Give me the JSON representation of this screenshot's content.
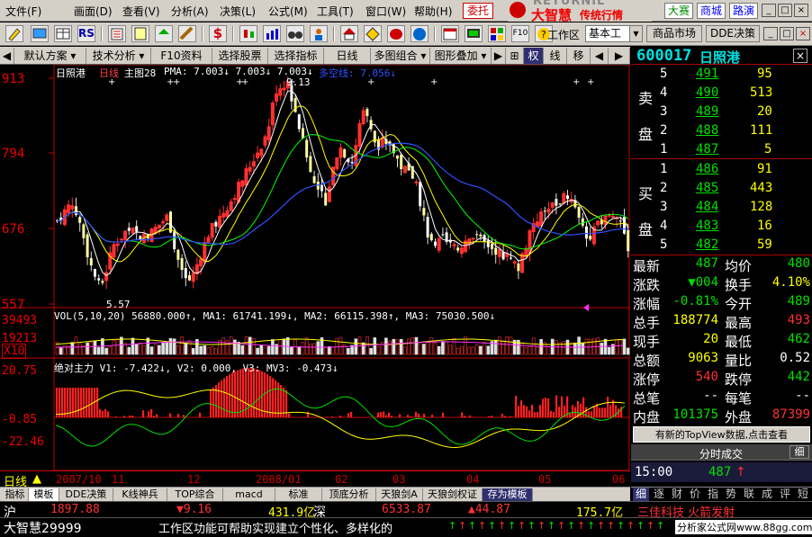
{
  "menu": {
    "items": [
      "文件(F)",
      "画面(D)",
      "查看(V)",
      "分析(A)",
      "决策(L)",
      "公式(M)",
      "工具(T)",
      "窗口(W)",
      "帮助(H)"
    ],
    "entrust": "委托",
    "logo_brand": "RETURNIL",
    "logo_main": "大智慧",
    "logo_sub": "传统行情",
    "btn_contest": "大赛",
    "btn_mall": "商城",
    "btn_roadshow": "路演",
    "win_min": "_",
    "win_max": "□",
    "win_close": "×"
  },
  "toolbar": {
    "icon_labels": [
      "RSI",
      "$",
      "F10"
    ],
    "workspace_label": "工作区",
    "workspace_value": "基本工",
    "btn_market": "商品市场",
    "btn_dde": "DDE决策"
  },
  "funcbar": {
    "items": [
      "默认方案",
      "技术分析",
      "F10资料",
      "选择股票",
      "选择指标",
      "日线",
      "多图组合",
      "图形叠加",
      "权",
      "线",
      "移"
    ]
  },
  "stock": {
    "code": "600017",
    "name": "日照港",
    "close_icon": "×"
  },
  "chart": {
    "name": "日照港",
    "period": "日线",
    "main_label": "主图28",
    "pma": "PMA: 7.003↓ 7.003↓ 7.003↓",
    "duo_kong": "多空线: 7.056↓",
    "high_mark": "9.13",
    "low_mark": "5.57",
    "y_labels": [
      "913",
      "794",
      "676",
      "557"
    ],
    "vol_line": "VOL(5,10,20) 56880.000↑, MA1: 61741.199↓, MA2: 66115.398↑, MA3: 75030.500↓",
    "vol_y": [
      "39493",
      "19213",
      "X10"
    ],
    "ind_line": "绝对主力  V1: -7.422↓, V2: 0.000, V3: MV3: -0.473↓",
    "ind_y": [
      "20.75",
      "-0.85",
      "-22.46"
    ],
    "x_period": "日线",
    "x_labels": [
      "2007/10",
      "11",
      "12",
      "2008/01",
      "02",
      "03",
      "04",
      "05",
      "06"
    ]
  },
  "quote": {
    "sell_title": "卖",
    "sell_title2": "盘",
    "buy_title": "买",
    "buy_title2": "盘",
    "sells": [
      {
        "lvl": "5",
        "price": "491",
        "vol": "95"
      },
      {
        "lvl": "4",
        "price": "490",
        "vol": "513"
      },
      {
        "lvl": "3",
        "price": "489",
        "vol": "20"
      },
      {
        "lvl": "2",
        "price": "488",
        "vol": "111"
      },
      {
        "lvl": "1",
        "price": "487",
        "vol": "5"
      }
    ],
    "buys": [
      {
        "lvl": "1",
        "price": "486",
        "vol": "91"
      },
      {
        "lvl": "2",
        "price": "485",
        "vol": "443"
      },
      {
        "lvl": "3",
        "price": "484",
        "vol": "128"
      },
      {
        "lvl": "4",
        "price": "483",
        "vol": "16"
      },
      {
        "lvl": "5",
        "price": "482",
        "vol": "59"
      }
    ],
    "stats": [
      {
        "l1": "最新",
        "v1": "487",
        "c1": "#00e000",
        "l2": "均价",
        "v2": "480",
        "c2": "#00e000"
      },
      {
        "l1": "涨跌",
        "v1": "▼004",
        "c1": "#00e000",
        "l2": "换手",
        "v2": "4.10%",
        "c2": "#ffff00"
      },
      {
        "l1": "涨幅",
        "v1": "-0.81%",
        "c1": "#00e000",
        "l2": "今开",
        "v2": "489",
        "c2": "#00e000"
      },
      {
        "l1": "总手",
        "v1": "188774",
        "c1": "#ffff00",
        "l2": "最高",
        "v2": "493",
        "c2": "#ff3030"
      },
      {
        "l1": "现手",
        "v1": "20",
        "c1": "#ffff00",
        "l2": "最低",
        "v2": "462",
        "c2": "#00e000"
      },
      {
        "l1": "总额",
        "v1": "9063",
        "c1": "#ffff00",
        "l2": "量比",
        "v2": "0.52",
        "c2": "#ffffff"
      },
      {
        "l1": "涨停",
        "v1": "540",
        "c1": "#ff3030",
        "l2": "跌停",
        "v2": "442",
        "c2": "#00e000"
      },
      {
        "l1": "总笔",
        "v1": "--",
        "c1": "#ffffff",
        "l2": "每笔",
        "v2": "--",
        "c2": "#ffffff"
      },
      {
        "l1": "内盘",
        "v1": "101375",
        "c1": "#00e000",
        "l2": "外盘",
        "v2": "87399",
        "c2": "#ff3030"
      }
    ],
    "topview": "有新的TopView数据,点击查看",
    "tick_header": "分时成交",
    "tick_btn": "细",
    "tick_time": "15:00",
    "tick_price": "487",
    "tick_arrow": "↑",
    "tabs": [
      "细",
      "逐",
      "财",
      "价",
      "指",
      "势",
      "联",
      "成",
      "评",
      "短"
    ]
  },
  "bottomtabs": [
    "指标",
    "模板",
    "DDE决策",
    "K线神兵",
    "TOP综合",
    "macd",
    "标准",
    "顶底分析",
    "天狼剑A",
    "天狼剑权证",
    "存为模板"
  ],
  "ticker": {
    "sh_label": "沪",
    "sh_index": "1897.88",
    "sh_change": "▼9.16",
    "sh_amount": "431.9亿",
    "sz_label": "深",
    "sz_index": "6533.87",
    "sz_change": "▲44.87",
    "sz_amount": "175.7亿",
    "news": "三佳科技 火箭发射"
  },
  "status": {
    "app": "大智慧29999",
    "msg": "工作区功能可帮助实现建立个性化、多样化的",
    "site": "分析家公式网www.88gg.com"
  },
  "colors": {
    "up": "#ff3030",
    "down": "#00e000",
    "axis": "#c00000",
    "bg": "#000000"
  }
}
